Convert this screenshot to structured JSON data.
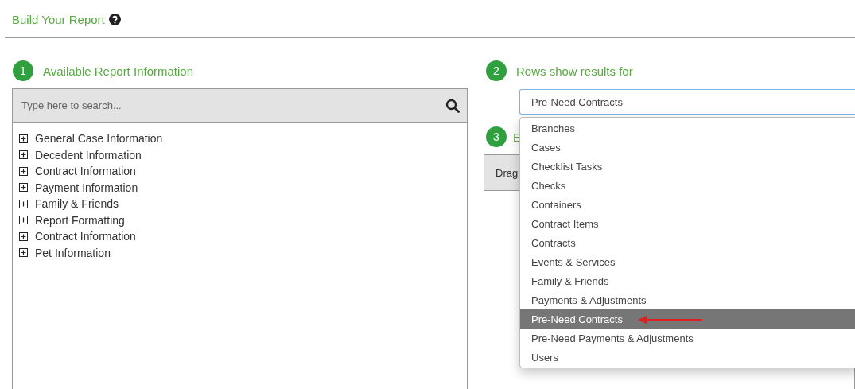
{
  "header": {
    "title": "Build Your Report"
  },
  "steps": [
    {
      "number": "1",
      "title": "Available Report Information"
    },
    {
      "number": "2",
      "title": "Rows show results for"
    },
    {
      "number": "3",
      "title": "E"
    }
  ],
  "search": {
    "placeholder": "Type here to search..."
  },
  "tree": [
    {
      "label": "General Case Information",
      "expanded": false
    },
    {
      "label": "Decedent Information",
      "expanded": false
    },
    {
      "label": "Contract Information",
      "expanded": false
    },
    {
      "label": "Payment Information",
      "expanded": false
    },
    {
      "label": "Family & Friends",
      "expanded": false
    },
    {
      "label": "Report Formatting",
      "expanded": false
    },
    {
      "label": "Contract Information",
      "expanded": false
    },
    {
      "label": "Pet Information",
      "expanded": false
    }
  ],
  "rows_select": {
    "value": "Pre-Need Contracts"
  },
  "dropdown": [
    {
      "label": "Branches",
      "selected": false
    },
    {
      "label": "Cases",
      "selected": false
    },
    {
      "label": "Checklist Tasks",
      "selected": false
    },
    {
      "label": "Checks",
      "selected": false
    },
    {
      "label": "Containers",
      "selected": false
    },
    {
      "label": "Contract Items",
      "selected": false
    },
    {
      "label": "Contracts",
      "selected": false
    },
    {
      "label": "Events & Services",
      "selected": false
    },
    {
      "label": "Family & Friends",
      "selected": false
    },
    {
      "label": "Payments & Adjustments",
      "selected": false
    },
    {
      "label": "Pre-Need Contracts",
      "selected": true
    },
    {
      "label": "Pre-Need Payments & Adjustments",
      "selected": false
    },
    {
      "label": "Users",
      "selected": false
    }
  ],
  "columns_panel": {
    "header": "Drag"
  }
}
